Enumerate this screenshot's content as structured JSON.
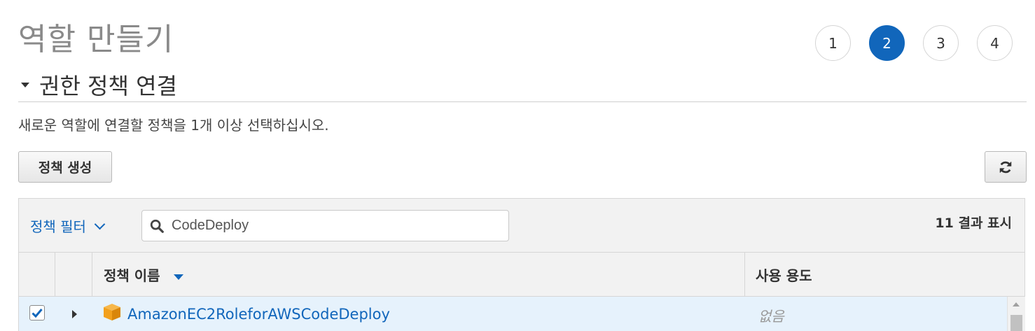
{
  "page": {
    "title": "역할 만들기"
  },
  "wizard_steps": [
    {
      "label": "1",
      "active": false
    },
    {
      "label": "2",
      "active": true
    },
    {
      "label": "3",
      "active": false
    },
    {
      "label": "4",
      "active": false
    }
  ],
  "section": {
    "title": "권한 정책 연결",
    "description": "새로운 역할에 연결할 정책을 1개 이상 선택하십시오."
  },
  "buttons": {
    "create_policy": "정책 생성",
    "refresh_icon": "refresh-icon"
  },
  "toolbar": {
    "filter_label": "정책 필터",
    "search_value": "CodeDeploy",
    "results_label": "11 결과 표시"
  },
  "table": {
    "columns": {
      "name": "정책 이름",
      "usage": "사용 용도"
    },
    "rows": [
      {
        "checked": true,
        "icon": "aws-managed-policy-icon",
        "name": "AmazonEC2RoleforAWSCodeDeploy",
        "usage": "없음"
      }
    ]
  },
  "colors": {
    "accent": "#1166bb",
    "selected_row": "#e6f2fc",
    "policy_icon": "#f2a01c"
  }
}
